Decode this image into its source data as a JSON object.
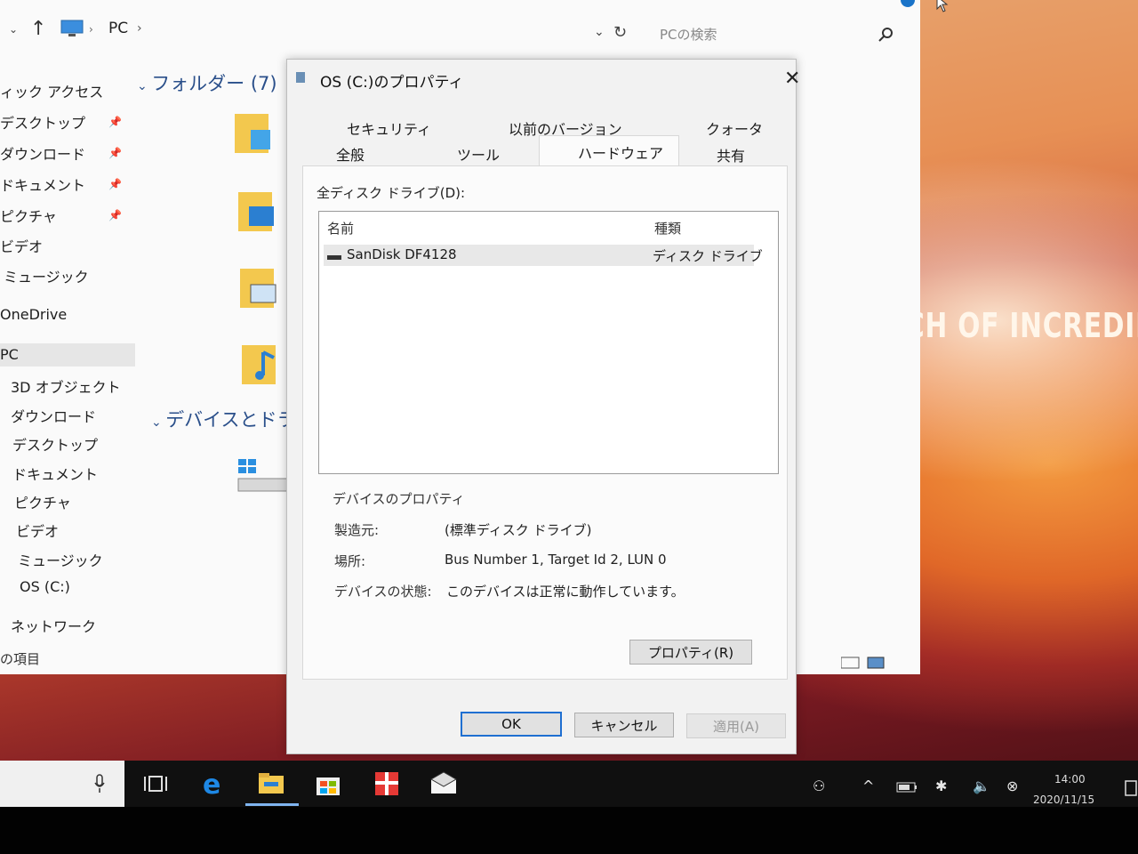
{
  "explorer": {
    "breadcrumb": "PC",
    "search_placeholder": "PCの検索",
    "nav": {
      "quick_access": "ィック アクセス",
      "desktop": "デスクトップ",
      "downloads": "ダウンロード",
      "documents": "ドキュメント",
      "pictures": "ピクチャ",
      "videos": "ビデオ",
      "music": "ミュージック",
      "onedrive": "OneDrive",
      "pc": "PC",
      "pc_3d": "3D オブジェクト",
      "pc_downloads": "ダウンロード",
      "pc_desktop": "デスクトップ",
      "pc_documents": "ドキュメント",
      "pc_pictures": "ピクチャ",
      "pc_videos": "ビデオ",
      "pc_music": "ミュージック",
      "pc_osc": "OS (C:)",
      "network": "ネットワーク"
    },
    "group_folders": "フォルダー (7)",
    "group_devices": "デバイスとドライブ",
    "status": "の項目"
  },
  "dialog": {
    "title": "OS (C:)のプロパティ",
    "tabs_row1": [
      "セキュリティ",
      "以前のバージョン",
      "クォータ"
    ],
    "tabs_row2": [
      "全般",
      "ツール",
      "ハードウェア",
      "共有"
    ],
    "active_tab": "ハードウェア",
    "all_disk_label": "全ディスク ドライブ(D):",
    "columns": [
      "名前",
      "種類"
    ],
    "rows": [
      {
        "name": "SanDisk DF4128",
        "type": "ディスク ドライブ"
      }
    ],
    "device_props_heading": "デバイスのプロパティ",
    "manufacturer_label": "製造元:",
    "manufacturer_value": "(標準ディスク ドライブ)",
    "location_label": "場所:",
    "location_value": "Bus Number 1, Target Id 2, LUN 0",
    "status_label": "デバイスの状態:",
    "status_value": "このデバイスは正常に動作しています。",
    "properties_button": "プロパティ(R)",
    "ok_button": "OK",
    "cancel_button": "キャンセル",
    "apply_button": "適用(A)"
  },
  "wallpaper_text": "CH OF INCREDIBL",
  "taskbar": {
    "time": "14:00",
    "date": "2020/11/15"
  },
  "colors": {
    "accent": "#1f6fd1",
    "taskbar": "#101010",
    "dialog_bg": "#f2f2f2"
  }
}
